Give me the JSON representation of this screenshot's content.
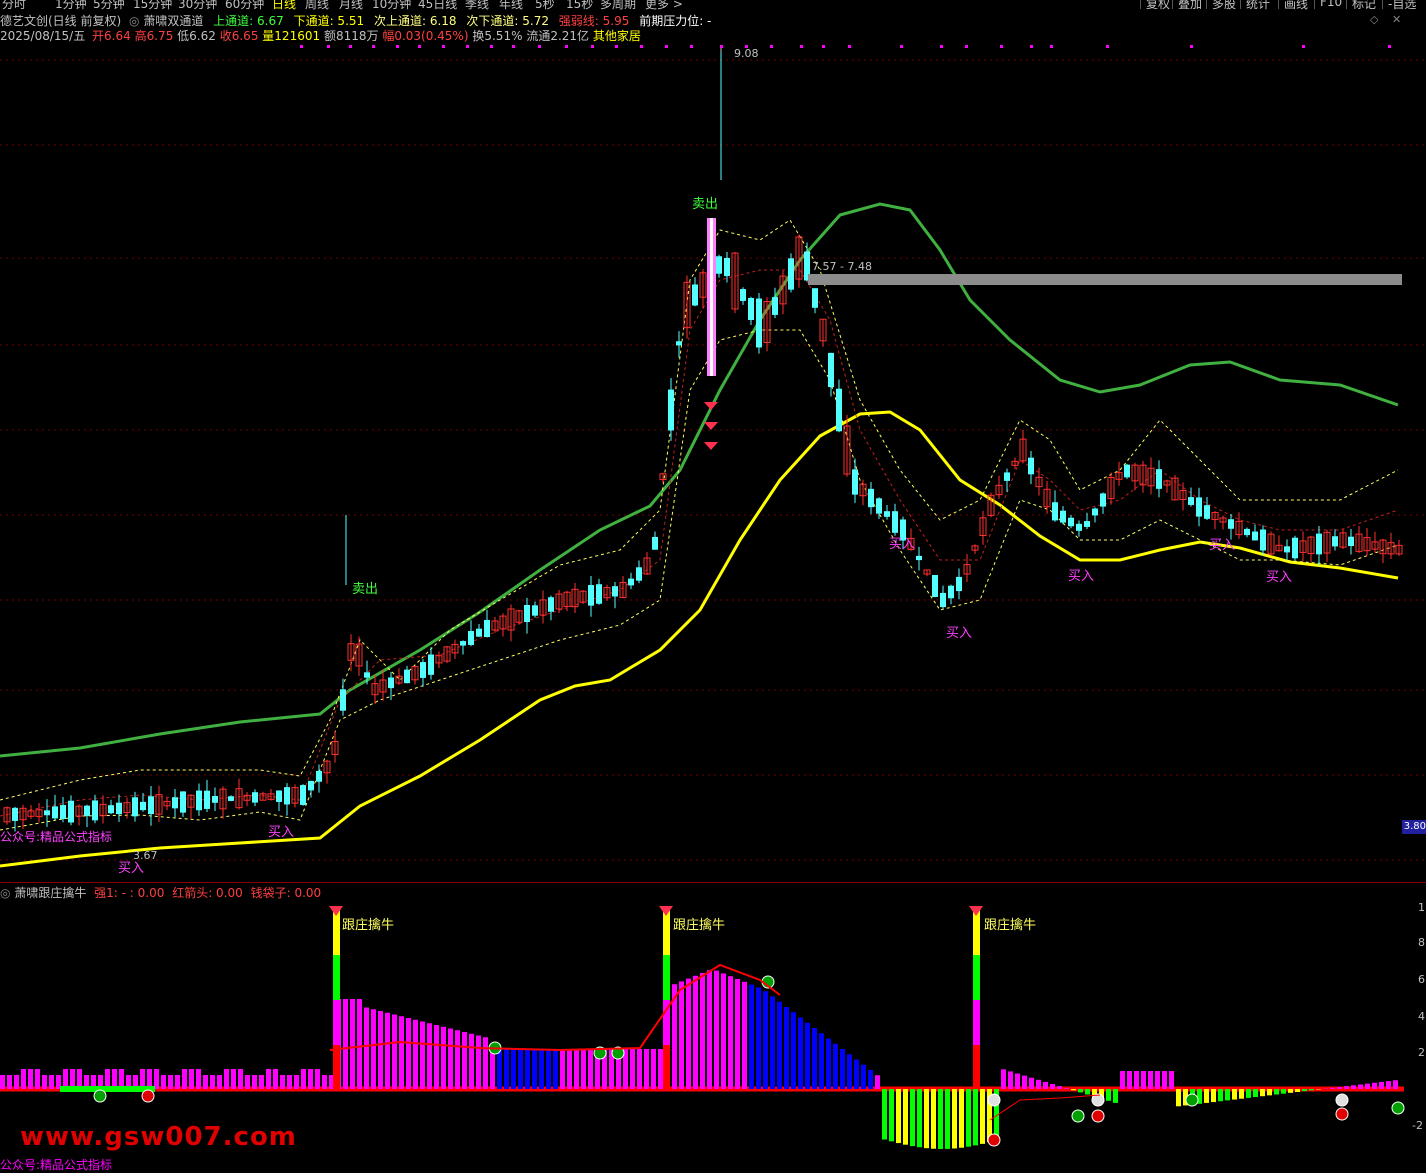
{
  "toolbar": {
    "periods": [
      "分时",
      "1分钟",
      "5分钟",
      "15分钟",
      "30分钟",
      "60分钟",
      "日线",
      "周线",
      "月线",
      "10分钟",
      "45日线",
      "季线",
      "年线",
      "5秒",
      "15秒",
      "多周期",
      "更多 >"
    ],
    "active_period": "日线",
    "right_buttons": [
      "复权",
      "叠加",
      "多股",
      "统计",
      "画线",
      "F10",
      "标记",
      "-自选"
    ]
  },
  "header": {
    "stock_title": "德艺文创(日线 前复权)",
    "indicator_name": "萧啸双通道",
    "upper_label": "上通道: 6.67",
    "lower_label": "下通道: 5.51",
    "sub_upper_label": "次上通道: 6.18",
    "sub_lower_label": "次下通道: 5.72",
    "strength_label": "强弱线: 5.95",
    "resistance_label": "前期压力位: -",
    "date": "2025/08/15/五",
    "open": "开6.64",
    "high": "高6.75",
    "low": "低6.62",
    "close": "收6.65",
    "volume": "量121601",
    "amount": "额8118万",
    "change": "幅0.03(0.45%)",
    "turnover": "换5.51%",
    "float_cap": "流通2.21亿",
    "sector": "其他家居"
  },
  "main_chart": {
    "annotations": {
      "high_price": "9.08",
      "low_price": "3.67",
      "resistance_zone": "7.57 - 7.48",
      "sell_label": "卖出",
      "buy_label": "买入",
      "brand_text": "公众号:精品公式指标"
    },
    "right_price_tag": "3.80",
    "colors": {
      "up_candle": "#ff3030",
      "down_candle": "#54ffff",
      "upper_channel": "#40b040",
      "lower_channel": "#ffff00",
      "dashed_upper": "#ffff60",
      "dashed_mid": "#c02020",
      "resistance_bar": "#909090",
      "signal_buy": "#ff40ff",
      "signal_sell": "#40ff40"
    }
  },
  "sub_chart": {
    "indicator_name": "萧啸跟庄擒牛",
    "strong_label": "强1: - : 0.00",
    "red_arrow_label": "红箭头: 0.00",
    "money_bag_label": "钱袋子: 0.00",
    "signal_label": "跟庄擒牛",
    "axis_ticks": [
      "1",
      "8",
      "6",
      "4",
      "2",
      "",
      "-2"
    ],
    "colors": {
      "magenta": "#ff00ff",
      "blue": "#0000ff",
      "yellow": "#ffff00",
      "green": "#00ff00",
      "zero_line": "#ff0000"
    }
  },
  "footer": {
    "watermark": "www.gsw007.com",
    "brand_text": "公众号:精品公式指标"
  }
}
